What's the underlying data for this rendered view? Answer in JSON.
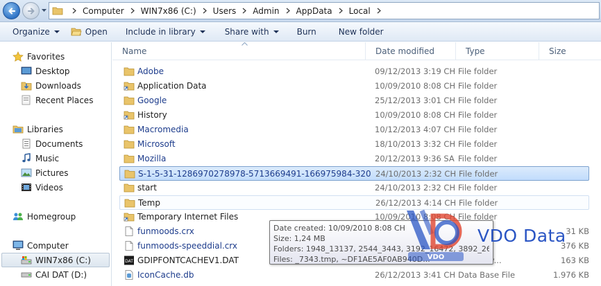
{
  "address": {
    "crumbs": [
      "Computer",
      "WIN7x86 (C:)",
      "Users",
      "Admin",
      "AppData",
      "Local"
    ]
  },
  "toolbar": {
    "organize": "Organize",
    "open": "Open",
    "include_in_library": "Include in library",
    "share_with": "Share with",
    "burn": "Burn",
    "new_folder": "New folder"
  },
  "nav": {
    "favorites": "Favorites",
    "desktop": "Desktop",
    "downloads": "Downloads",
    "recent_places": "Recent Places",
    "libraries": "Libraries",
    "documents": "Documents",
    "music": "Music",
    "pictures": "Pictures",
    "videos": "Videos",
    "homegroup": "Homegroup",
    "computer": "Computer",
    "drive_c": "WIN7x86 (C:)",
    "drive_d": "CAI DAT (D:)"
  },
  "columns": {
    "name": "Name",
    "date_modified": "Date modified",
    "type": "Type",
    "size": "Size"
  },
  "files": [
    {
      "name": "Adobe",
      "date": "09/12/2013 3:19 CH",
      "type": "File folder",
      "size": "",
      "icon": "folder-icon"
    },
    {
      "name": "Application Data",
      "date": "10/09/2010 8:08 CH",
      "type": "File folder",
      "size": "",
      "icon": "folder-shortcut-icon"
    },
    {
      "name": "Google",
      "date": "25/12/2013 3:01 CH",
      "type": "File folder",
      "size": "",
      "icon": "folder-icon"
    },
    {
      "name": "History",
      "date": "10/09/2010 8:08 CH",
      "type": "File folder",
      "size": "",
      "icon": "folder-shortcut-icon"
    },
    {
      "name": "Macromedia",
      "date": "10/12/2013 4:07 CH",
      "type": "File folder",
      "size": "",
      "icon": "folder-icon"
    },
    {
      "name": "Microsoft",
      "date": "18/10/2013 3:32 CH",
      "type": "File folder",
      "size": "",
      "icon": "folder-icon"
    },
    {
      "name": "Mozilla",
      "date": "20/12/2013 9:36 SA",
      "type": "File folder",
      "size": "",
      "icon": "folder-icon"
    },
    {
      "name": "S-1-5-31-1286970278978-5713669491-166975984-320",
      "date": "24/10/2013 2:32 CH",
      "type": "File folder",
      "size": "",
      "icon": "folder-icon"
    },
    {
      "name": "start",
      "date": "24/10/2013 2:32 CH",
      "type": "File folder",
      "size": "",
      "icon": "folder-icon"
    },
    {
      "name": "Temp",
      "date": "26/12/2013 4:14 CH",
      "type": "File folder",
      "size": "",
      "icon": "folder-icon"
    },
    {
      "name": "Temporary Internet Files",
      "date": "10/09/2010 8:08 CH",
      "type": "File folder",
      "size": "",
      "icon": "folder-shortcut-icon"
    },
    {
      "name": "funmoods.crx",
      "date": "",
      "type": "",
      "size": "31 KB",
      "icon": "document-icon"
    },
    {
      "name": "funmoods-speeddial.crx",
      "date": "",
      "type": "",
      "size": "376 KB",
      "icon": "document-icon"
    },
    {
      "name": "GDIPFONTCACHEV1.DAT",
      "date": "",
      "type": "PEG Mov...",
      "size": "163 KB",
      "icon": "dat-file-icon"
    },
    {
      "name": "IconCache.db",
      "date": "26/12/2013 3:41 CH",
      "type": "Data Base File",
      "size": "1.976 KB",
      "icon": "database-icon"
    }
  ],
  "tooltip": {
    "line1": "Date created: 10/09/2010 8:08 CH",
    "line2": "Size: 1,24 MB",
    "line3": "Folders: 1948_13137, 2544_3443, 3192_16472, 3892_26824, ...",
    "line4": "Files: _7343.tmp, ~DF1AE5AF0AB940D..."
  },
  "watermark": {
    "text": "VDO Data",
    "logo_letters": "VDO"
  },
  "colors": {
    "selection": "#c1dcfc",
    "link_text": "#1d3c8c",
    "watermark": "#2a55c4",
    "watermark_red": "#e0452f"
  }
}
